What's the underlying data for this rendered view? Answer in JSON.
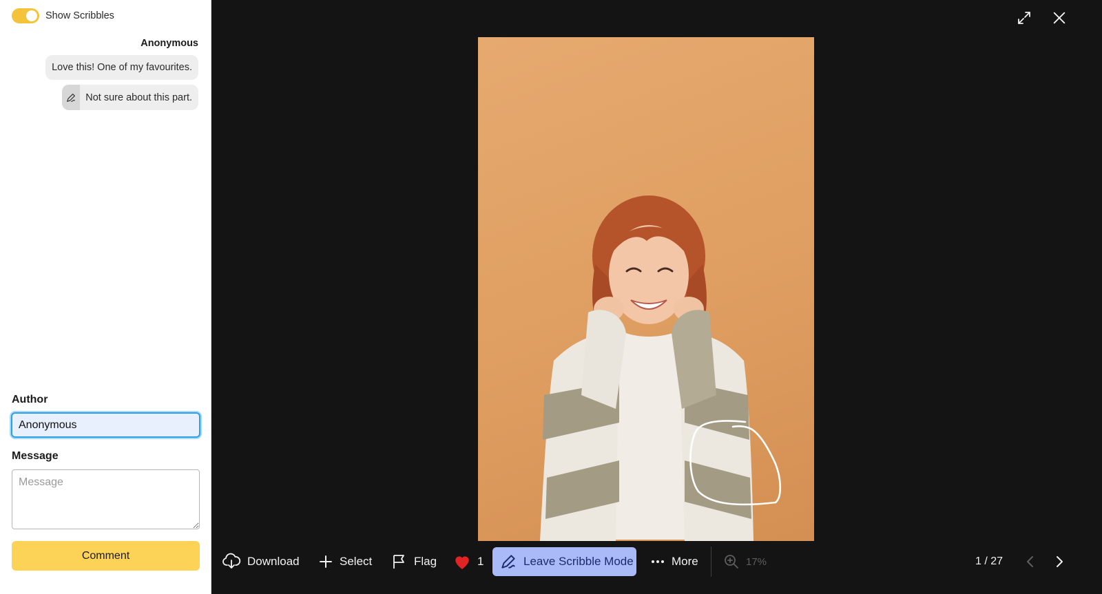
{
  "sidebar": {
    "toggle": {
      "label": "Show Scribbles",
      "on": true
    },
    "thread": {
      "author": "Anonymous",
      "comments": [
        {
          "text": "Love this! One of my favourites.",
          "scribble": false
        },
        {
          "text": "Not sure about this part.",
          "scribble": true
        }
      ]
    },
    "form": {
      "author_label": "Author",
      "author_value": "Anonymous",
      "message_label": "Message",
      "message_placeholder": "Message",
      "submit_label": "Comment"
    }
  },
  "toolbar": {
    "download_label": "Download",
    "select_label": "Select",
    "flag_label": "Flag",
    "like_count": "1",
    "scribble_label": "Leave Scribble Mode",
    "more_label": "More",
    "zoom_value": "17%",
    "image_counter": "1 / 27"
  },
  "colors": {
    "accent_yellow": "#fcd357",
    "toggle_on": "#f3c33b",
    "scribble_mode_bg": "#aab9f8",
    "like_red": "#e02424",
    "focus_blue": "#2d9fe6",
    "viewer_bg": "#141414"
  },
  "icons": [
    "fullscreen-icon",
    "close-icon",
    "scribble-icon",
    "download-icon",
    "plus-icon",
    "flag-icon",
    "heart-icon",
    "more-icon",
    "zoom-icon",
    "chevron-left-icon",
    "chevron-right-icon"
  ]
}
